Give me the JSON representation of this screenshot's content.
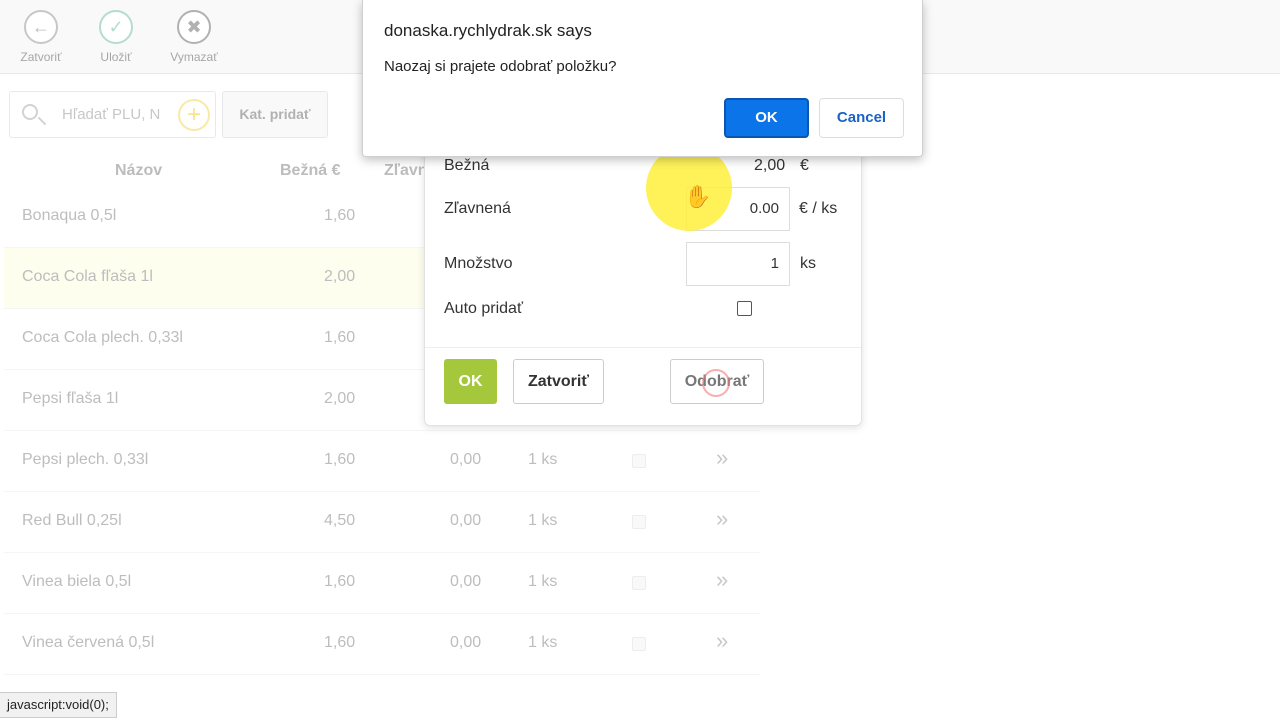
{
  "toolbar": {
    "back_label": "Zatvoriť",
    "save_label": "Uložiť",
    "delete_label": "Vymazať"
  },
  "search": {
    "placeholder": "Hľadať PLU, N",
    "cat_add_label": "Kat. pridať"
  },
  "table": {
    "headers": {
      "name": "Názov",
      "regular": "Bežná €",
      "discount": "Zľavn"
    },
    "rows": [
      {
        "name": "Bonaqua 0,5l",
        "regular": "1,60",
        "discount": "",
        "qty": ""
      },
      {
        "name": "Coca Cola fľaša 1l",
        "regular": "2,00",
        "discount": "",
        "qty": ""
      },
      {
        "name": "Coca Cola plech. 0,33l",
        "regular": "1,60",
        "discount": "",
        "qty": ""
      },
      {
        "name": "Pepsi fľaša 1l",
        "regular": "2,00",
        "discount": "",
        "qty": ""
      },
      {
        "name": "Pepsi plech. 0,33l",
        "regular": "1,60",
        "discount": "0,00",
        "qty": "1 ks"
      },
      {
        "name": "Red Bull 0,25l",
        "regular": "4,50",
        "discount": "0,00",
        "qty": "1 ks"
      },
      {
        "name": "Vinea biela 0,5l",
        "regular": "1,60",
        "discount": "0,00",
        "qty": "1 ks"
      },
      {
        "name": "Vinea červená 0,5l",
        "regular": "1,60",
        "discount": "0,00",
        "qty": "1 ks"
      }
    ]
  },
  "dialog": {
    "regular_label": "Bežná",
    "regular_value": "2,00",
    "regular_unit": "€",
    "discount_label": "Zľavnená",
    "discount_value": "0.00",
    "discount_unit": "€ / ks",
    "qty_label": "Množstvo",
    "qty_value": "1",
    "qty_unit": "ks",
    "auto_label": "Auto pridať",
    "ok_label": "OK",
    "close_label": "Zatvoriť",
    "remove_label": "Odobrať"
  },
  "alert": {
    "title": "donaska.rychlydrak.sk says",
    "message": "Naozaj si prajete odobrať položku?",
    "ok_label": "OK",
    "cancel_label": "Cancel"
  },
  "status": {
    "text": "javascript:void(0);"
  },
  "colors": {
    "ok_green": "#a5c73c",
    "alert_blue": "#0b74e8",
    "highlight_yellow": "#fff03c"
  }
}
